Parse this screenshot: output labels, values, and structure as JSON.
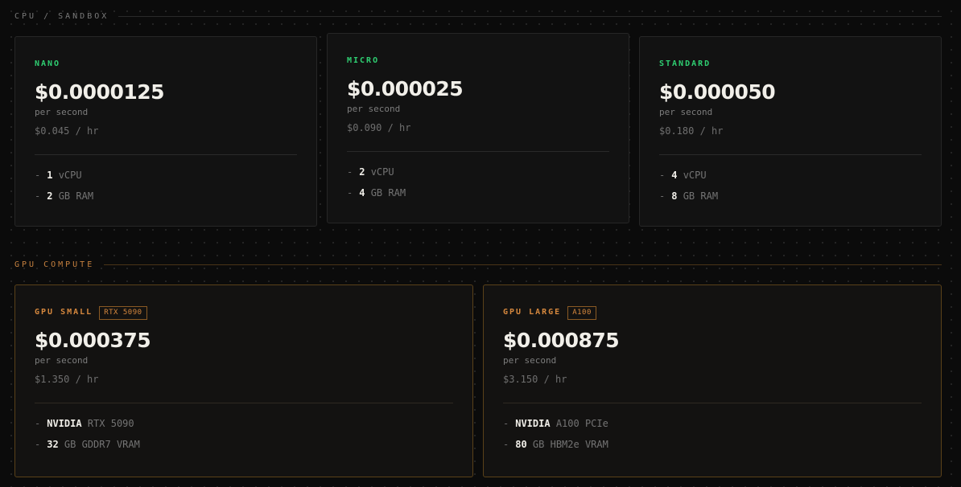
{
  "cpu_section": {
    "title": "CPU / SANDBOX"
  },
  "gpu_section": {
    "title": "GPU COMPUTE"
  },
  "cpu_cards": [
    {
      "tier": "NANO",
      "price": "$0.0000125",
      "per": "per second",
      "hourly": "$0.045 / hr",
      "specs": [
        {
          "value": "1",
          "unit": "vCPU"
        },
        {
          "value": "2",
          "unit": "GB RAM"
        }
      ]
    },
    {
      "tier": "MICRO",
      "price": "$0.000025",
      "per": "per second",
      "hourly": "$0.090 / hr",
      "specs": [
        {
          "value": "2",
          "unit": "vCPU"
        },
        {
          "value": "4",
          "unit": "GB RAM"
        }
      ]
    },
    {
      "tier": "STANDARD",
      "price": "$0.000050",
      "per": "per second",
      "hourly": "$0.180 / hr",
      "specs": [
        {
          "value": "4",
          "unit": "vCPU"
        },
        {
          "value": "8",
          "unit": "GB RAM"
        }
      ]
    }
  ],
  "gpu_cards": [
    {
      "tier": "GPU SMALL",
      "badge": "RTX 5090",
      "price": "$0.000375",
      "per": "per second",
      "hourly": "$1.350 / hr",
      "specs": [
        {
          "value": "NVIDIA",
          "unit": "RTX 5090"
        },
        {
          "value": "32",
          "unit": "GB GDDR7 VRAM"
        }
      ]
    },
    {
      "tier": "GPU LARGE",
      "badge": "A100",
      "price": "$0.000875",
      "per": "per second",
      "hourly": "$3.150 / hr",
      "specs": [
        {
          "value": "NVIDIA",
          "unit": "A100 PCIe"
        },
        {
          "value": "80",
          "unit": "GB HBM2e VRAM"
        }
      ]
    }
  ],
  "spec_dash": "-",
  "colors": {
    "cpu_accent": "#2fcf72",
    "gpu_accent": "#d6883e",
    "background": "#0b0b0b"
  }
}
